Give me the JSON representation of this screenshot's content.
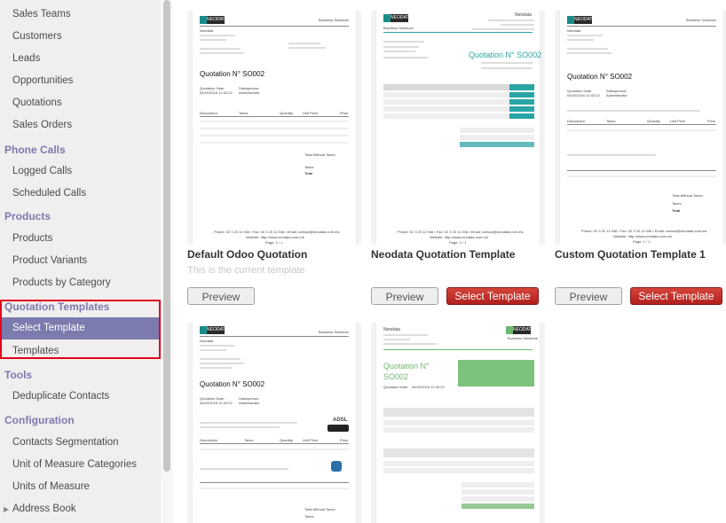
{
  "sidebar": {
    "items": [
      {
        "label": "Sales Teams"
      },
      {
        "label": "Customers"
      },
      {
        "label": "Leads"
      },
      {
        "label": "Opportunities"
      },
      {
        "label": "Quotations"
      },
      {
        "label": "Sales Orders"
      }
    ],
    "sections": {
      "phone_calls": "Phone Calls",
      "products": "Products",
      "quotation_templates": "Quotation Templates",
      "tools": "Tools",
      "configuration": "Configuration"
    },
    "phone_items": [
      {
        "label": "Logged Calls"
      },
      {
        "label": "Scheduled Calls"
      }
    ],
    "product_items": [
      {
        "label": "Products"
      },
      {
        "label": "Product Variants"
      },
      {
        "label": "Products by Category"
      }
    ],
    "template_items": [
      {
        "label": "Select Template"
      },
      {
        "label": "Templates"
      }
    ],
    "tool_items": [
      {
        "label": "Deduplicate Contacts"
      }
    ],
    "config_items": [
      {
        "label": "Contacts Segmentation"
      },
      {
        "label": "Unit of Measure Categories"
      },
      {
        "label": "Units of Measure"
      },
      {
        "label": "Address Book"
      }
    ],
    "active_item": "Select Template"
  },
  "cards": [
    {
      "title": "Default Odoo Quotation",
      "subtitle": "This is the current template",
      "preview": "Preview"
    },
    {
      "title": "Neodata Quotation Template",
      "preview": "Preview",
      "select": "Select Template"
    },
    {
      "title": "Custom Quotation Template 1",
      "preview": "Preview",
      "select": "Select Template"
    },
    {
      "title": "",
      "preview": "",
      "select": ""
    },
    {
      "title": "",
      "preview": "",
      "select": ""
    }
  ],
  "doc": {
    "logo": "NEODATA",
    "business": "Business Solutions",
    "company": "Neodata",
    "quotation": "Quotation N° SO002",
    "quotation_split_1": "Quotation N°",
    "quotation_split_2": "SO002",
    "date_label": "Quotation Date:",
    "date_value": "04/20/2016 12:42:22",
    "salesperson_label": "Salesperson:",
    "salesperson_value": "Administrator",
    "col_description": "Description",
    "col_taxes": "Taxes",
    "col_quantity": "Quantity",
    "col_unit_price": "Unit Price",
    "col_price": "Price",
    "total_without_taxes": "Total Without Taxes",
    "taxes": "Taxes",
    "total": "Total",
    "adsl": "ADSL",
    "footer": "Phone: 02 3 20 11 946 • Fax: 02 3 20 11 946 • Email: contact@neodata.com.mk",
    "website": "Website: http://www.neodata.com.mk",
    "page": "Page: 1 / 1"
  },
  "colors": {
    "accent": "#7c7bad",
    "select_button": "#c62f2a",
    "teal": "#2aa5a5",
    "green": "#70b96f",
    "highlight": "#e0001b"
  }
}
